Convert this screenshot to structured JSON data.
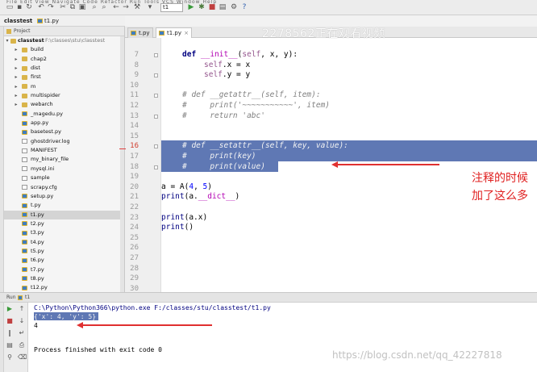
{
  "menubar": {
    "menu_items": "File  Edit  View  Navigate  Code  Refactor  Run  Tools  VCS  Window  Help",
    "run_config": "t1",
    "icons": [
      "open-icon",
      "save-icon",
      "sync-icon",
      "back-icon",
      "forward-icon",
      "cut-icon",
      "copy-icon",
      "paste-icon",
      "find-icon",
      "replace-icon",
      "back-nav-icon",
      "forward-nav-icon",
      "run-icon",
      "debug-icon",
      "stop-icon",
      "build-icon",
      "settings-icon",
      "help-icon"
    ],
    "help_label": "?"
  },
  "navbar": {
    "crumbs": [
      "classtest",
      "t1.py"
    ]
  },
  "project": {
    "header": "Project",
    "root": "classtest",
    "root_path": "F:\\classes\\stu\\classtest",
    "items": [
      {
        "label": "build",
        "kind": "folder"
      },
      {
        "label": "chap2",
        "kind": "folder"
      },
      {
        "label": "dist",
        "kind": "folder"
      },
      {
        "label": "first",
        "kind": "folder"
      },
      {
        "label": "m",
        "kind": "folder"
      },
      {
        "label": "multispider",
        "kind": "folder"
      },
      {
        "label": "webarch",
        "kind": "folder"
      },
      {
        "label": "_magedu.py",
        "kind": "py"
      },
      {
        "label": "app.py",
        "kind": "py"
      },
      {
        "label": "basetest.py",
        "kind": "py"
      },
      {
        "label": "ghostdriver.log",
        "kind": "file"
      },
      {
        "label": "MANIFEST",
        "kind": "file"
      },
      {
        "label": "my_binary_file",
        "kind": "file"
      },
      {
        "label": "mysql.ini",
        "kind": "file"
      },
      {
        "label": "sample",
        "kind": "file"
      },
      {
        "label": "scrapy.cfg",
        "kind": "file"
      },
      {
        "label": "setup.py",
        "kind": "py"
      },
      {
        "label": "t.py",
        "kind": "py"
      },
      {
        "label": "t1.py",
        "kind": "py",
        "selected": true
      },
      {
        "label": "t2.py",
        "kind": "py"
      },
      {
        "label": "t3.py",
        "kind": "py"
      },
      {
        "label": "t4.py",
        "kind": "py"
      },
      {
        "label": "t5.py",
        "kind": "py"
      },
      {
        "label": "t6.py",
        "kind": "py"
      },
      {
        "label": "t7.py",
        "kind": "py"
      },
      {
        "label": "t8.py",
        "kind": "py"
      },
      {
        "label": "t12.py",
        "kind": "py"
      }
    ]
  },
  "tabs": [
    {
      "label": "t.py",
      "active": false
    },
    {
      "label": "t1.py",
      "active": true
    }
  ],
  "editor": {
    "line_numbers": [
      "7",
      "8",
      "9",
      "10",
      "11",
      "12",
      "13",
      "14",
      "15",
      "16",
      "17",
      "18",
      "19",
      "20",
      "21",
      "22",
      "23",
      "24",
      "25",
      "26",
      "27",
      "28",
      "29",
      "30"
    ],
    "current_line": "16",
    "lines": {
      "l7_kw": "def ",
      "l7_fn": "__init__",
      "l7_a": "(",
      "l7_self": "self",
      "l7_b": ", x, y):",
      "l8_self": "self",
      "l8_rest": ".x = x",
      "l9_self": "self",
      "l9_rest": ".y = y",
      "l11": "# def __getattr__(self, item):",
      "l12": "#     print('~~~~~~~~~~~', item)",
      "l13": "#     return 'abc'",
      "l16": "# def __setattr__(self, key, value):",
      "l17": "#     print(key)",
      "l18": "#     print(value)",
      "l20_a": "a = A(",
      "l20_n1": "4",
      "l20_b": ", ",
      "l20_n2": "5",
      "l20_c": ")",
      "l21_fn": "print",
      "l21_a": "(a.",
      "l21_m": "__dict__",
      "l21_b": ")",
      "l23_fn": "print",
      "l23_rest": "(a.x)",
      "l24_fn": "print",
      "l24_rest": "()"
    }
  },
  "watermark": "2278562正在观看视频",
  "annotation": {
    "note": "注释的时候加了这么多"
  },
  "run_panel": {
    "header": "Run",
    "config": "t1",
    "console": {
      "command": "C:\\Python\\Python366\\python.exe F:/classes/stu/classtest/t1.py",
      "out1": "{'x': 4, 'y': 5}",
      "out2": "4",
      "finished": "Process finished with exit code 0"
    }
  },
  "csdn_watermark": "https://blog.csdn.net/qq_42227818"
}
